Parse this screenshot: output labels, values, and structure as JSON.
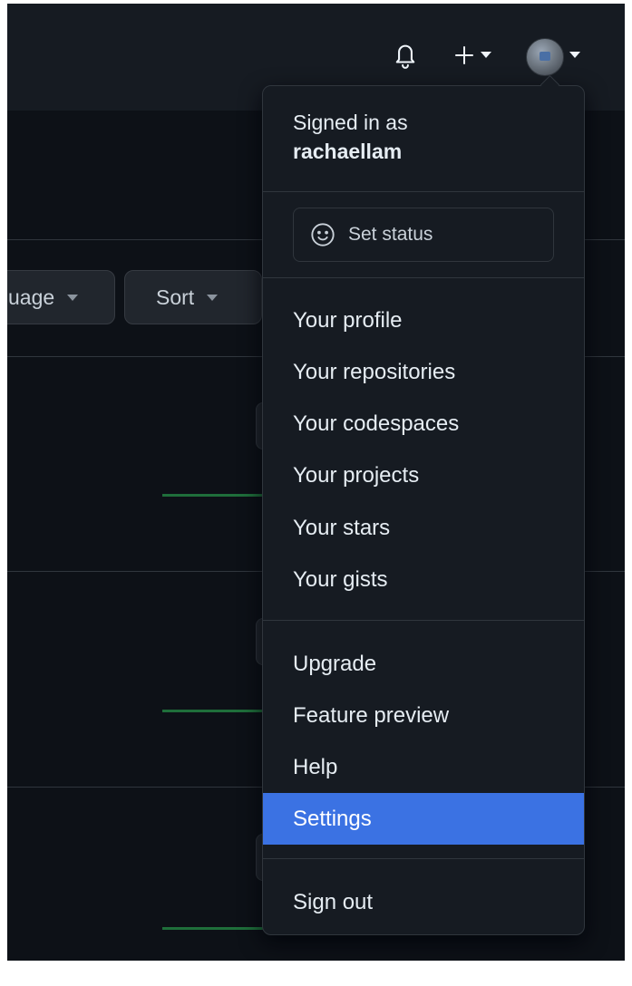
{
  "header": {
    "icons": {
      "notifications": "bell-icon",
      "create": "plus-icon",
      "create_caret": "caret-down-icon",
      "avatar_caret": "caret-down-icon"
    }
  },
  "filters": {
    "language_label": "uage",
    "sort_label": "Sort"
  },
  "user_menu": {
    "signed_in_prefix": "Signed in as",
    "username": "rachaellam",
    "set_status_label": "Set status",
    "section1": [
      {
        "label": "Your profile"
      },
      {
        "label": "Your repositories"
      },
      {
        "label": "Your codespaces"
      },
      {
        "label": "Your projects"
      },
      {
        "label": "Your stars"
      },
      {
        "label": "Your gists"
      }
    ],
    "section2": [
      {
        "label": "Upgrade"
      },
      {
        "label": "Feature preview"
      },
      {
        "label": "Help"
      },
      {
        "label": "Settings",
        "active": true
      }
    ],
    "sign_out_label": "Sign out"
  },
  "colors": {
    "page_bg": "#0d1117",
    "header_bg": "#161b22",
    "menu_bg": "#161b22",
    "border": "#30363d",
    "active_item": "#3b72e3",
    "text": "#e6edf3",
    "accent_green": "#1f6f3b"
  }
}
